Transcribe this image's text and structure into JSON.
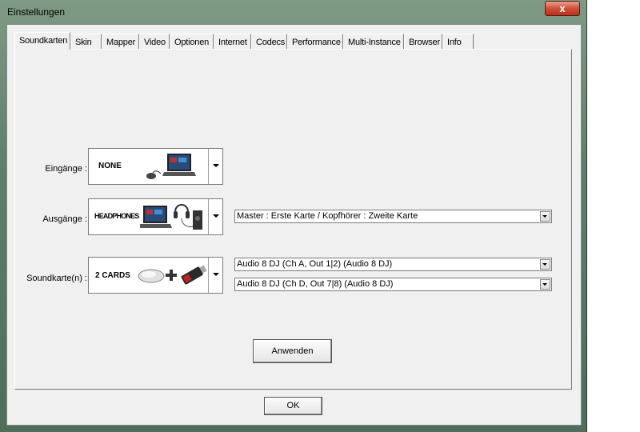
{
  "window": {
    "title": "Einstellungen",
    "close_glyph": "x"
  },
  "tabs": [
    "Soundkarten",
    "Skin",
    "Mapper",
    "Video",
    "Optionen",
    "Internet",
    "Codecs",
    "Performance",
    "Multi-Instance",
    "Browser",
    "Info"
  ],
  "active_tab": "Soundkarten",
  "inputs": {
    "label": "Eingänge :",
    "image_text": "NONE"
  },
  "outputs": {
    "label": "Ausgänge :",
    "image_text": "HEADPHONES",
    "select_value": "Master : Erste Karte / Kopfhörer : Zweite Karte"
  },
  "soundcards": {
    "label": "Soundkarte(n) :",
    "image_text": "2 CARDS",
    "select1_value": "Audio 8 DJ (Ch A, Out 1|2) (Audio 8 DJ)",
    "select2_value": "Audio 8 DJ (Ch D, Out 7|8) (Audio 8 DJ)"
  },
  "apply_button": "Anwenden",
  "ok_button": "OK",
  "colors": {
    "close_button": "#c8412a",
    "dialog_bg": "#f0f0f0",
    "frame": "#5f7d6a"
  }
}
